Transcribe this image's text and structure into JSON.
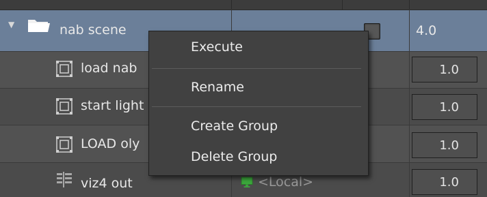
{
  "tree": {
    "root": {
      "label": "nab scene",
      "value": "4.0"
    },
    "children": [
      {
        "label": "load nab",
        "value": "1.0"
      },
      {
        "label": "start light",
        "value": "1.0"
      },
      {
        "label": "LOAD oly",
        "value": "1.0"
      },
      {
        "label": "viz4 out",
        "value": "1.0",
        "host": "<Local>"
      }
    ]
  },
  "context_menu": {
    "items": [
      "Execute",
      "Rename",
      "Create Group",
      "Delete Group"
    ]
  },
  "colors": {
    "selection": "#6b7f99",
    "menu_bg": "#414141",
    "host_green": "#3ca83c"
  },
  "icons": {
    "folder": "folder-icon",
    "command": "command-icon",
    "output": "output-icon",
    "monitor": "monitor-icon",
    "expand": "expand-arrow-icon"
  }
}
